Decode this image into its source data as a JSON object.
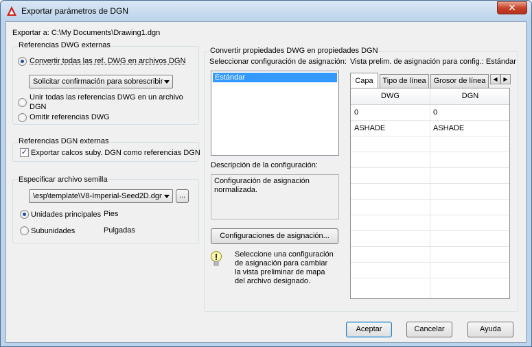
{
  "window": {
    "title": "Exportar parámetros de DGN",
    "close_label": "✕"
  },
  "export_path": "Exportar a: C:\\My Documents\\Drawing1.dgn",
  "dwg_refs": {
    "group_label": "Referencias DWG externas",
    "opt_convert": "Convertir todas las ref. DWG en archivos DGN",
    "overwrite_combo": "Solicitar confirmación para sobrescribir",
    "opt_merge_line1": "Unir todas las referencias DWG en un archivo",
    "opt_merge_line2": "DGN",
    "opt_omit": "Omitir referencias DWG"
  },
  "dgn_refs": {
    "group_label": "Referencias DGN externas",
    "chk_export": "Exportar calcos suby. DGN como referencias DGN",
    "chk_mark": "✓"
  },
  "seed": {
    "group_label": "Especificar archivo semilla",
    "file_combo": "\\esp\\template\\V8-Imperial-Seed2D.dgn",
    "browse_label": "...",
    "opt_main_units": "Unidades principales",
    "main_units_value": "Pies",
    "opt_sub_units": "Subunidades",
    "sub_units_value": "Pulgadas"
  },
  "convert": {
    "group_label": "Convertir propiedades DWG en propiedades DGN",
    "select_label": "Seleccionar configuración de asignación:",
    "setups": [
      "Estándar"
    ],
    "desc_label": "Descripción de la configuración:",
    "desc_text_line1": "Configuración de asignación",
    "desc_text_line2": "normalizada.",
    "setups_button": "Configuraciones de asignación...",
    "hint_line1": "Seleccione una configuración",
    "hint_line2": "de asignación para cambiar",
    "hint_line3": "la vista preliminar de mapa",
    "hint_line4": "del archivo designado."
  },
  "preview": {
    "label": "Vista prelim. de asignación para config.: Estándar",
    "tabs": [
      "Capa",
      "Tipo de línea",
      "Grosor de línea"
    ],
    "scroll_left": "◀",
    "scroll_right": "▶",
    "columns": [
      "DWG",
      "DGN"
    ],
    "rows": [
      [
        "0",
        "0"
      ],
      [
        "ASHADE",
        "ASHADE"
      ]
    ]
  },
  "footer": {
    "accept": "Aceptar",
    "cancel": "Cancelar",
    "help": "Ayuda"
  }
}
